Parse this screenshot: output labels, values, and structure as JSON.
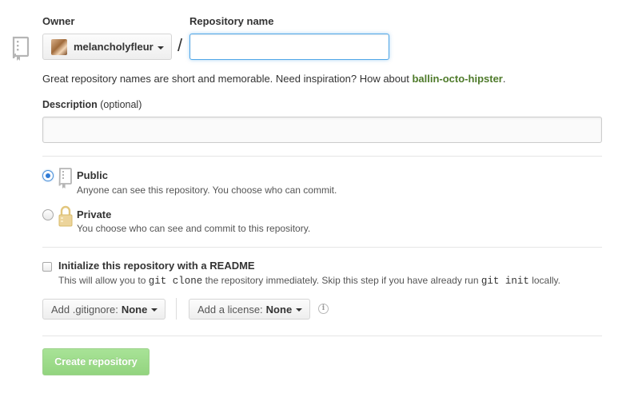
{
  "owner": {
    "label": "Owner",
    "selected": "melancholyfleur"
  },
  "repository_name": {
    "label": "Repository name",
    "separator": "/",
    "value": ""
  },
  "hint": {
    "text": "Great repository names are short and memorable. Need inspiration? How about ",
    "suggestion": "ballin-octo-hipster",
    "end": "."
  },
  "description": {
    "label": "Description",
    "optional": "(optional)",
    "value": ""
  },
  "visibility": {
    "selected": "public",
    "public": {
      "title": "Public",
      "desc": "Anyone can see this repository. You choose who can commit."
    },
    "private": {
      "title": "Private",
      "desc": "You choose who can see and commit to this repository."
    }
  },
  "readme": {
    "checked": false,
    "title": "Initialize this repository with a README",
    "desc_1": "This will allow you to ",
    "code_1": "git clone",
    "desc_2": " the repository immediately. Skip this step if you have already run ",
    "code_2": "git init",
    "desc_3": " locally."
  },
  "gitignore": {
    "label": "Add .gitignore:",
    "value": "None"
  },
  "license": {
    "label": "Add a license:",
    "value": "None"
  },
  "info_icon": {
    "glyph": "i"
  },
  "submit": {
    "label": "Create repository",
    "enabled": false
  },
  "colors": {
    "accent_blue": "#51a7e8",
    "suggestion_green": "#4e7a2a",
    "create_button_disabled": "#93d47f"
  },
  "icons": [
    "repo-book-icon",
    "avatar",
    "caret-down-icon",
    "public-repo-icon",
    "lock-icon",
    "info-icon"
  ]
}
